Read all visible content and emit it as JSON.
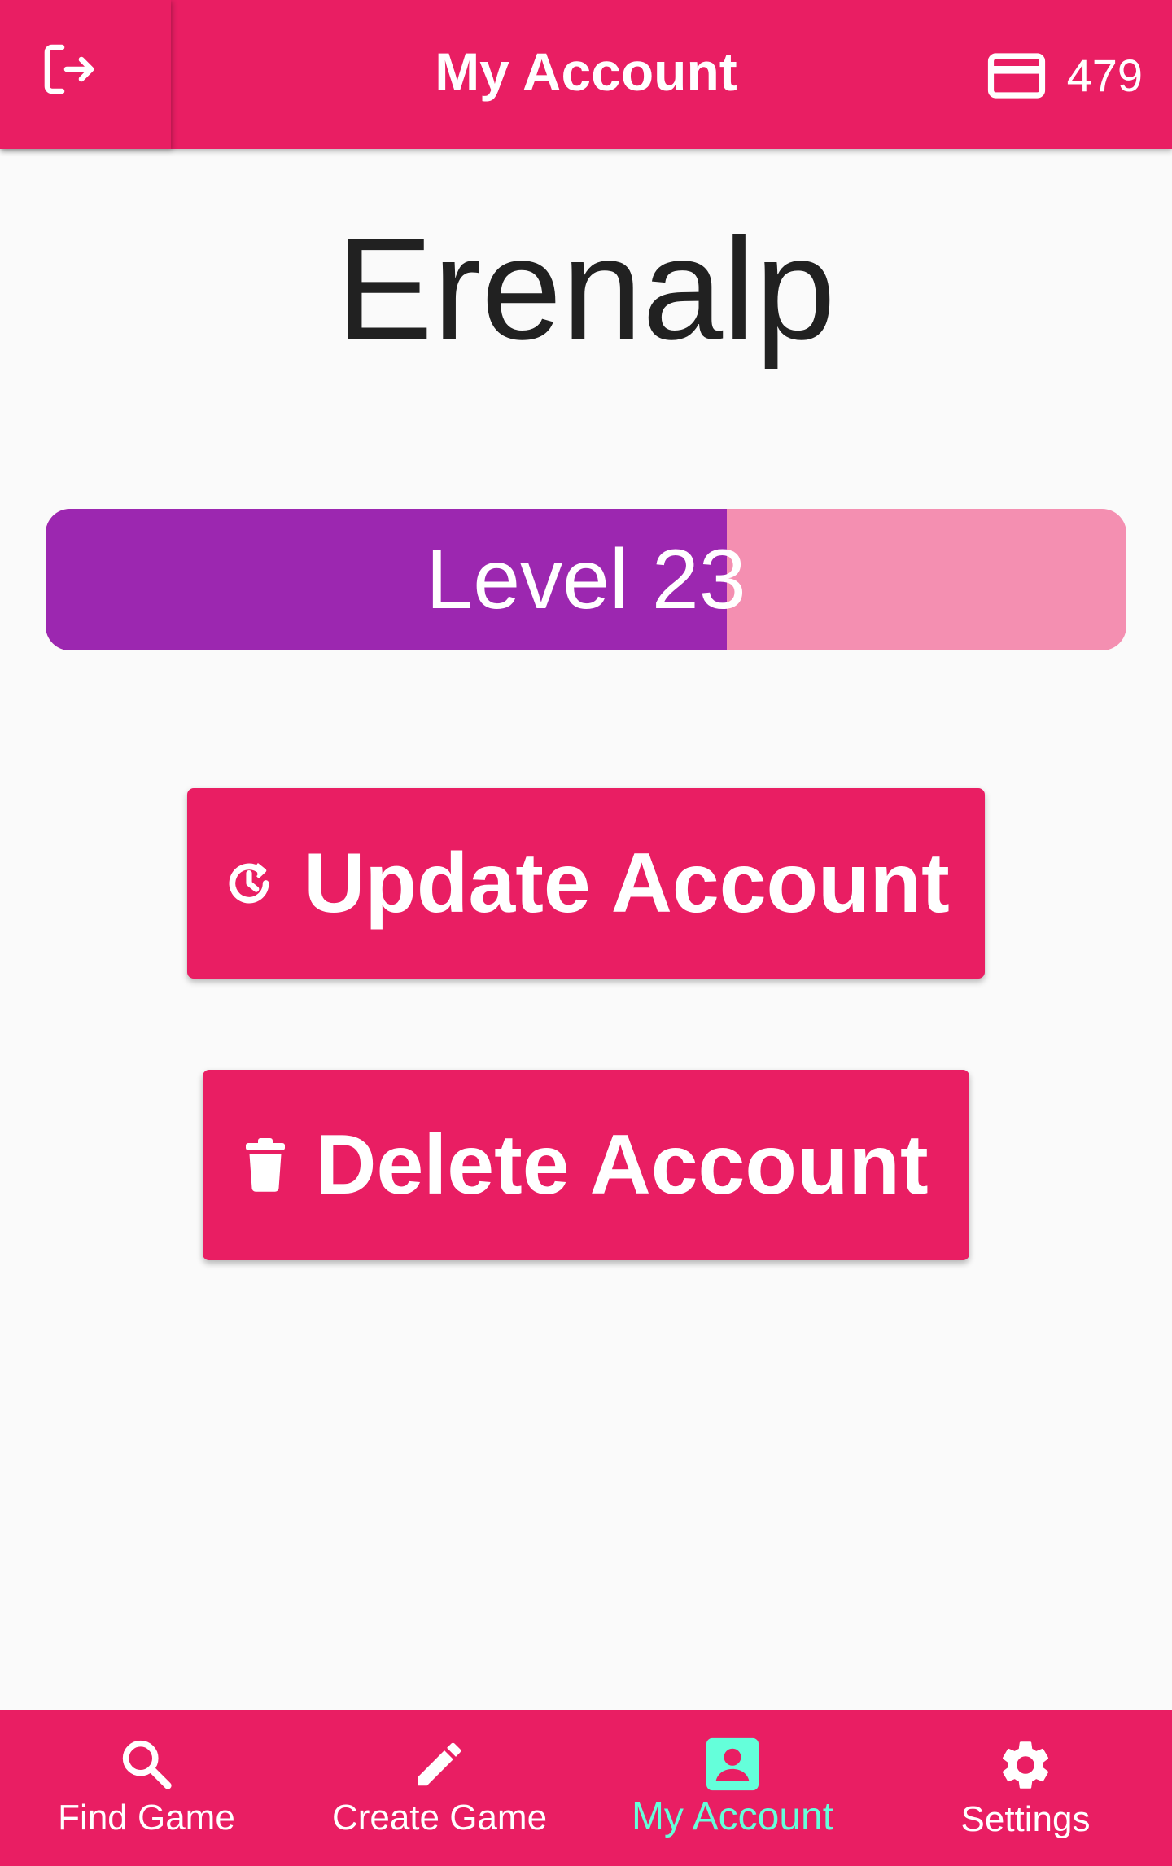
{
  "appbar": {
    "title": "My Account",
    "coins": "479",
    "logout_icon": "logout-icon",
    "coins_icon": "credit-card-icon"
  },
  "profile": {
    "username": "Erenalp",
    "level_label": "Level 23",
    "level_progress": 0.63
  },
  "actions": {
    "update_label": "Update Account",
    "update_icon": "update-clock-icon",
    "delete_label": "Delete Account",
    "delete_icon": "trash-icon"
  },
  "bottom_nav": {
    "items": [
      {
        "label": "Find Game",
        "icon": "search-icon",
        "active": false
      },
      {
        "label": "Create Game",
        "icon": "pencil-icon",
        "active": false
      },
      {
        "label": "My Account",
        "icon": "account-box-icon",
        "active": true
      },
      {
        "label": "Settings",
        "icon": "gear-icon",
        "active": false
      }
    ]
  },
  "colors": {
    "primary": "#e91e63",
    "level_fill": "#9c27b0",
    "level_track": "#f48fb1",
    "active_nav": "#64ffda",
    "background": "#fafafa"
  }
}
